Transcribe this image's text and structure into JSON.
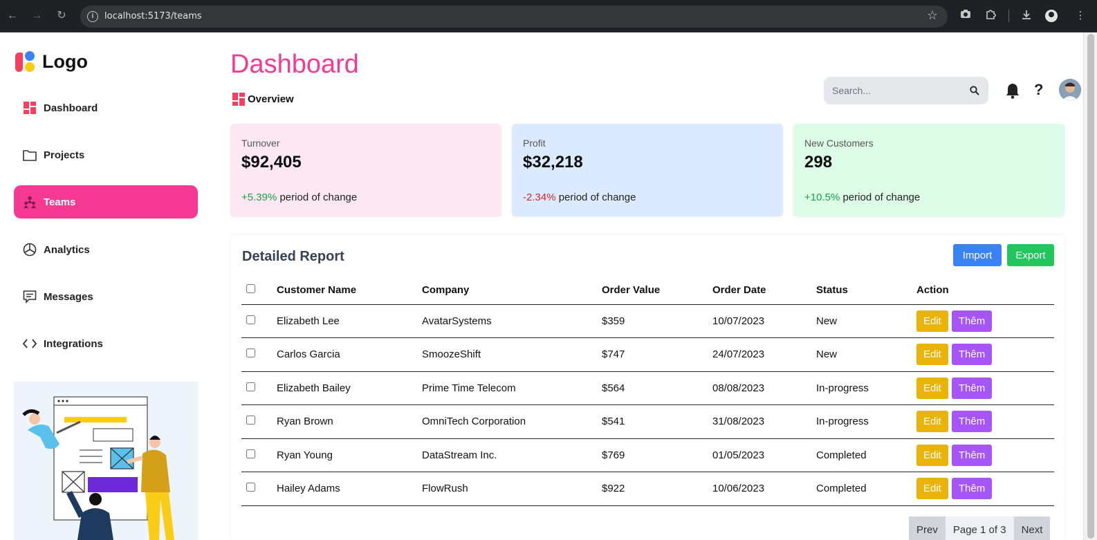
{
  "browser": {
    "url": "localhost:5173/teams",
    "icons": [
      "back-icon",
      "forward-icon",
      "reload-icon",
      "info-icon",
      "bookmark-star-icon",
      "camera-icon",
      "extensions-icon",
      "download-icon",
      "profile-icon"
    ]
  },
  "sidebar": {
    "logo_text": "Logo",
    "items": [
      {
        "label": "Dashboard",
        "icon": "dashboard-grid-icon"
      },
      {
        "label": "Projects",
        "icon": "folder-icon"
      },
      {
        "label": "Teams",
        "icon": "teams-icon",
        "active": true
      },
      {
        "label": "Analytics",
        "icon": "pie-chart-icon"
      },
      {
        "label": "Messages",
        "icon": "message-icon"
      },
      {
        "label": "Integrations",
        "icon": "code-icon"
      }
    ]
  },
  "header": {
    "title": "Dashboard",
    "breadcrumb": "Overview",
    "search_placeholder": "Search...",
    "help_glyph": "?"
  },
  "cards": [
    {
      "label": "Turnover",
      "value": "$92,405",
      "change": "+5.39%",
      "change_text": " period of change",
      "bg": "#fce7f3",
      "trend": "positive"
    },
    {
      "label": "Profit",
      "value": "$32,218",
      "change": "-2.34%",
      "change_text": " period of change",
      "bg": "#dbeafe",
      "trend": "negative"
    },
    {
      "label": "New Customers",
      "value": "298",
      "change": "+10.5%",
      "change_text": " period of change",
      "bg": "#dcfce7",
      "trend": "positive"
    }
  ],
  "report": {
    "title": "Detailed Report",
    "import_label": "Import",
    "export_label": "Export",
    "columns": [
      "Customer Name",
      "Company",
      "Order Value",
      "Order Date",
      "Status",
      "Action"
    ],
    "rows": [
      {
        "name": "Elizabeth Lee",
        "company": "AvatarSystems",
        "value": "$359",
        "date": "10/07/2023",
        "status": "New"
      },
      {
        "name": "Carlos Garcia",
        "company": "SmoozeShift",
        "value": "$747",
        "date": "24/07/2023",
        "status": "New"
      },
      {
        "name": "Elizabeth Bailey",
        "company": "Prime Time Telecom",
        "value": "$564",
        "date": "08/08/2023",
        "status": "In-progress"
      },
      {
        "name": "Ryan Brown",
        "company": "OmniTech Corporation",
        "value": "$541",
        "date": "31/08/2023",
        "status": "In-progress"
      },
      {
        "name": "Ryan Young",
        "company": "DataStream Inc.",
        "value": "$769",
        "date": "01/05/2023",
        "status": "Completed"
      },
      {
        "name": "Hailey Adams",
        "company": "FlowRush",
        "value": "$922",
        "date": "10/06/2023",
        "status": "Completed"
      }
    ],
    "edit_label": "Edit",
    "more_label": "Thêm",
    "pagination": {
      "prev": "Prev",
      "info": "Page 1 of 3",
      "next": "Next"
    }
  },
  "colors": {
    "accent": "#f63a94",
    "import": "#3b82f6",
    "export": "#22c55e",
    "edit": "#eab308",
    "more": "#a855f7"
  }
}
